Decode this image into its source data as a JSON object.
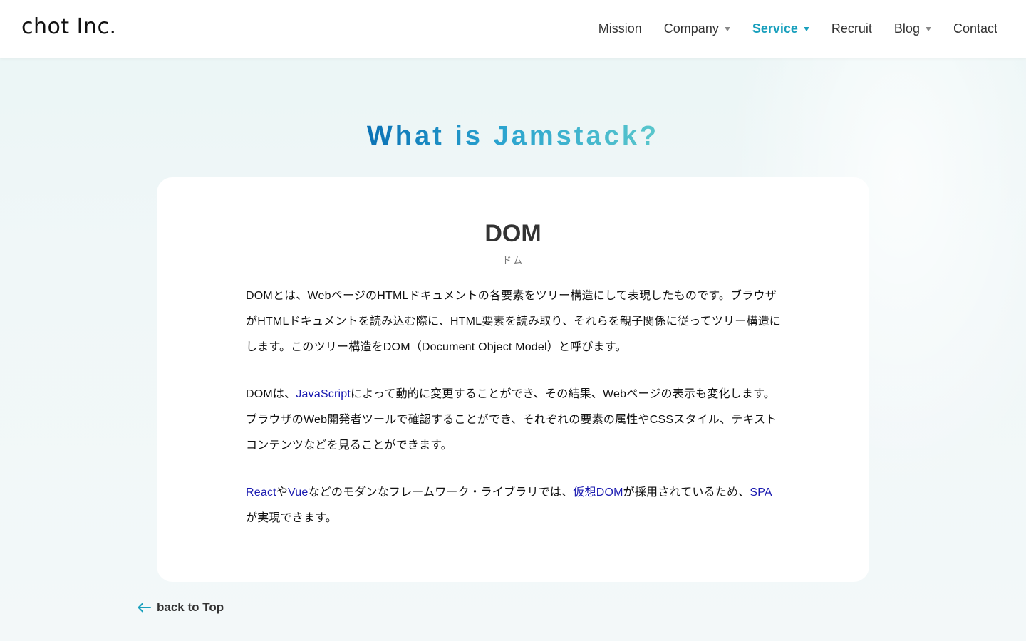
{
  "header": {
    "logo": "chot Inc.",
    "nav": [
      {
        "label": "Mission",
        "dropdown": false,
        "active": false
      },
      {
        "label": "Company",
        "dropdown": true,
        "active": false
      },
      {
        "label": "Service",
        "dropdown": true,
        "active": true
      },
      {
        "label": "Recruit",
        "dropdown": false,
        "active": false
      },
      {
        "label": "Blog",
        "dropdown": true,
        "active": false
      },
      {
        "label": "Contact",
        "dropdown": false,
        "active": false
      }
    ]
  },
  "section_title": "What is Jamstack?",
  "card": {
    "term": "DOM",
    "reading": "ドム",
    "paragraphs": {
      "p1": "DOMとは、WebページのHTMLドキュメントの各要素をツリー構造にして表現したものです。ブラウザがHTMLドキュメントを読み込む際に、HTML要素を読み取り、それらを親子関係に従ってツリー構造にします。このツリー構造をDOM（Document Object Model）と呼びます。",
      "p2_a": "DOMは、",
      "p2_link": "JavaScript",
      "p2_b": "によって動的に変更することができ、その結果、Webページの表示も変化します。ブラウザのWeb開発者ツールで確認することができ、それぞれの要素の属性やCSSスタイル、テキストコンテンツなどを見ることができます。",
      "p3_link1": "React",
      "p3_a": "や",
      "p3_link2": "Vue",
      "p3_b": "などのモダンなフレームワーク・ライブラリでは、",
      "p3_link3": "仮想DOM",
      "p3_c": "が採用されているため、",
      "p3_link4": "SPA",
      "p3_d": "が実現できます。"
    }
  },
  "back_link": "back to Top",
  "colors": {
    "accent": "#1aa0bd",
    "link": "#1a1ab0",
    "title_gradient_start": "#0b72b5",
    "title_gradient_end": "#5ac7cc"
  }
}
